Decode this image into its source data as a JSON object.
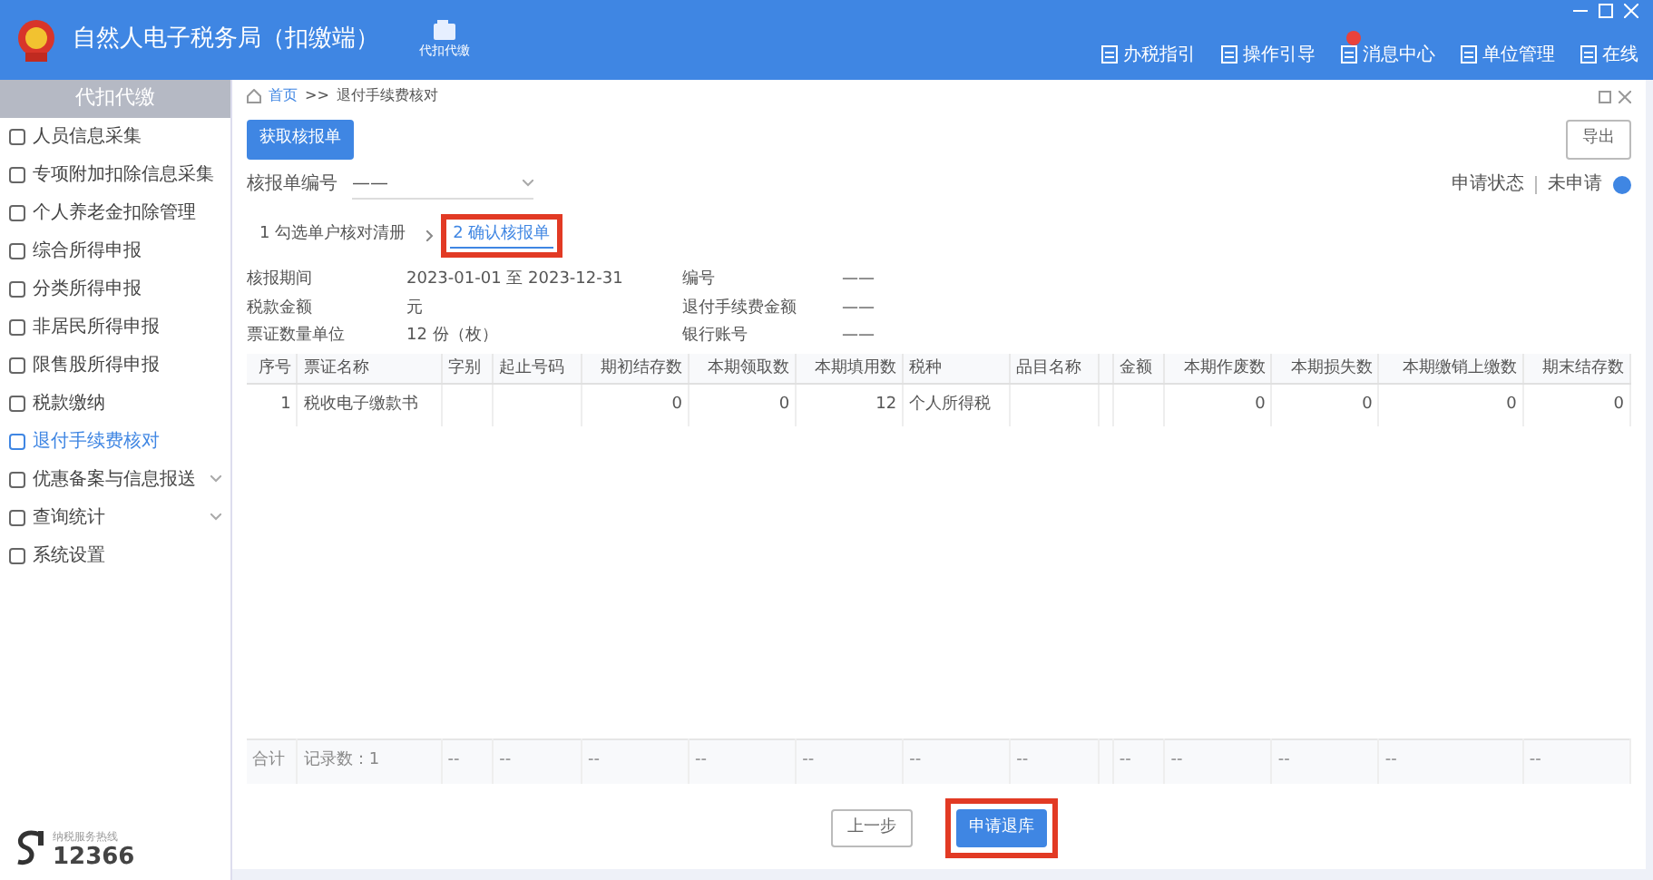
{
  "window": {
    "title": "自然人电子税务局（扣缴端）",
    "module": "代扣代缴",
    "actions": [
      {
        "label": "办税指引",
        "badge": false
      },
      {
        "label": "操作引导",
        "badge": false
      },
      {
        "label": "消息中心",
        "badge": true
      },
      {
        "label": "单位管理",
        "badge": false
      },
      {
        "label": "在线",
        "badge": false
      }
    ]
  },
  "sidebar": {
    "heading": "代扣代缴",
    "items": [
      {
        "label": "人员信息采集",
        "selected": false,
        "expandable": false
      },
      {
        "label": "专项附加扣除信息采集",
        "selected": false,
        "expandable": false
      },
      {
        "label": "个人养老金扣除管理",
        "selected": false,
        "expandable": false
      },
      {
        "label": "综合所得申报",
        "selected": false,
        "expandable": false
      },
      {
        "label": "分类所得申报",
        "selected": false,
        "expandable": false
      },
      {
        "label": "非居民所得申报",
        "selected": false,
        "expandable": false
      },
      {
        "label": "限售股所得申报",
        "selected": false,
        "expandable": false
      },
      {
        "label": "税款缴纳",
        "selected": false,
        "expandable": false
      },
      {
        "label": "退付手续费核对",
        "selected": true,
        "expandable": false
      },
      {
        "label": "优惠备案与信息报送",
        "selected": false,
        "expandable": true
      },
      {
        "label": "查询统计",
        "selected": false,
        "expandable": true
      },
      {
        "label": "系统设置",
        "selected": false,
        "expandable": false
      }
    ],
    "hotline": {
      "caption": "纳税服务热线",
      "number": "12366"
    }
  },
  "breadcrumb": [
    "首页",
    ">>",
    "退付手续费核对"
  ],
  "fetch_button": "获取核报单",
  "export_button": "导出",
  "report_no": {
    "label": "核报单编号",
    "value": "——"
  },
  "status": {
    "label": "申请状态",
    "value": "未申请"
  },
  "steps": [
    {
      "label": "1 勾选单户核对清册",
      "selected": false,
      "highlighted": false
    },
    {
      "label": "2 确认核报单",
      "selected": true,
      "highlighted": true
    }
  ],
  "info": [
    {
      "label": "核报期间",
      "value": "2023-01-01 至 2023-12-31"
    },
    {
      "label": "编号",
      "value": "——"
    },
    {
      "label": "税款金额",
      "value": "元"
    },
    {
      "label": "退付手续费金额",
      "value": "——"
    },
    {
      "label": "票证数量单位",
      "value": "12 份（枚）"
    },
    {
      "label": "银行账号",
      "value": "——"
    }
  ],
  "table": {
    "columns": [
      "序号",
      "票证名称",
      "字别",
      "起止号码",
      "期初结存数",
      "本期领取数",
      "本期填用数",
      "税种",
      "品目名称",
      null,
      "金额",
      "本期作废数",
      "本期损失数",
      "本期缴销上缴数",
      "期末结存数"
    ],
    "rows": [
      [
        "1",
        "税收电子缴款书",
        null,
        null,
        "0",
        "0",
        "12",
        "个人所得税",
        null,
        null,
        null,
        "0",
        "0",
        "0",
        "0"
      ]
    ],
    "footer": [
      "合计",
      "记录数：1",
      "--",
      "--",
      "--",
      "--",
      "--",
      "--",
      "--",
      "--",
      "--",
      "--",
      "--",
      "--"
    ]
  },
  "buttons": [
    {
      "label": "上一步",
      "kind": "secondary",
      "highlighted": false
    },
    {
      "label": "申请退库",
      "kind": "primary",
      "highlighted": true
    }
  ]
}
